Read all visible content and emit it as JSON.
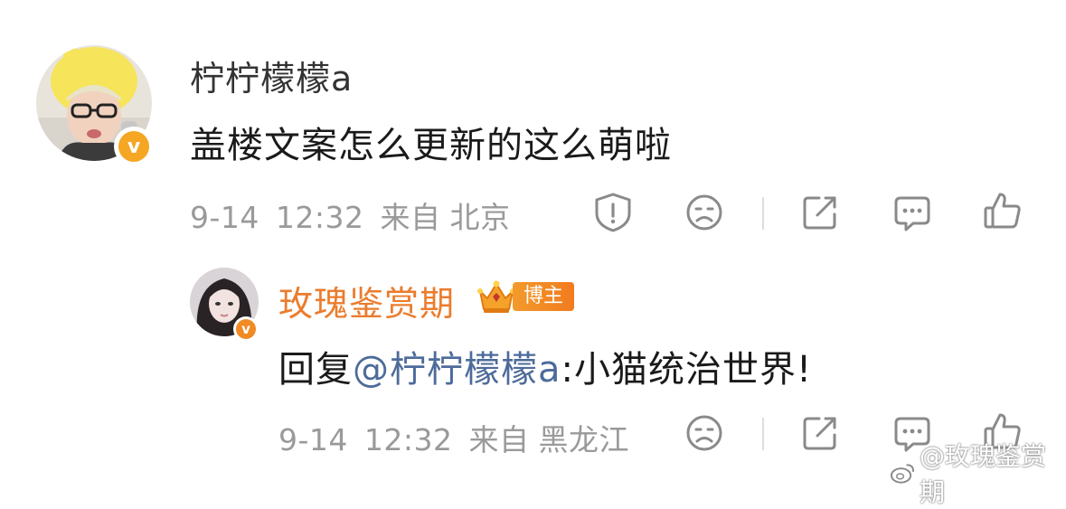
{
  "comment": {
    "username": "柠柠檬檬a",
    "text": "盖楼文案怎么更新的这么萌啦",
    "date": "9-14",
    "time": "12:32",
    "from_label": "来自",
    "location": "北京",
    "avatar_icon": "duck-hat-avatar",
    "verified_color": "#f5a623"
  },
  "reply": {
    "username": "玫瑰鉴赏期",
    "username_color": "#eb7c2d",
    "badge_label": "博主",
    "reply_prefix": "回复",
    "mention": "@柠柠檬檬a",
    "separator": ":",
    "text": "小猫统治世界!",
    "date": "9-14",
    "time": "12:32",
    "from_label": "来自",
    "location": "黑龙江",
    "avatar_icon": "portrait-avatar",
    "verified_color": "#f08a24"
  },
  "watermark": {
    "text": "@玫瑰鉴赏期"
  }
}
